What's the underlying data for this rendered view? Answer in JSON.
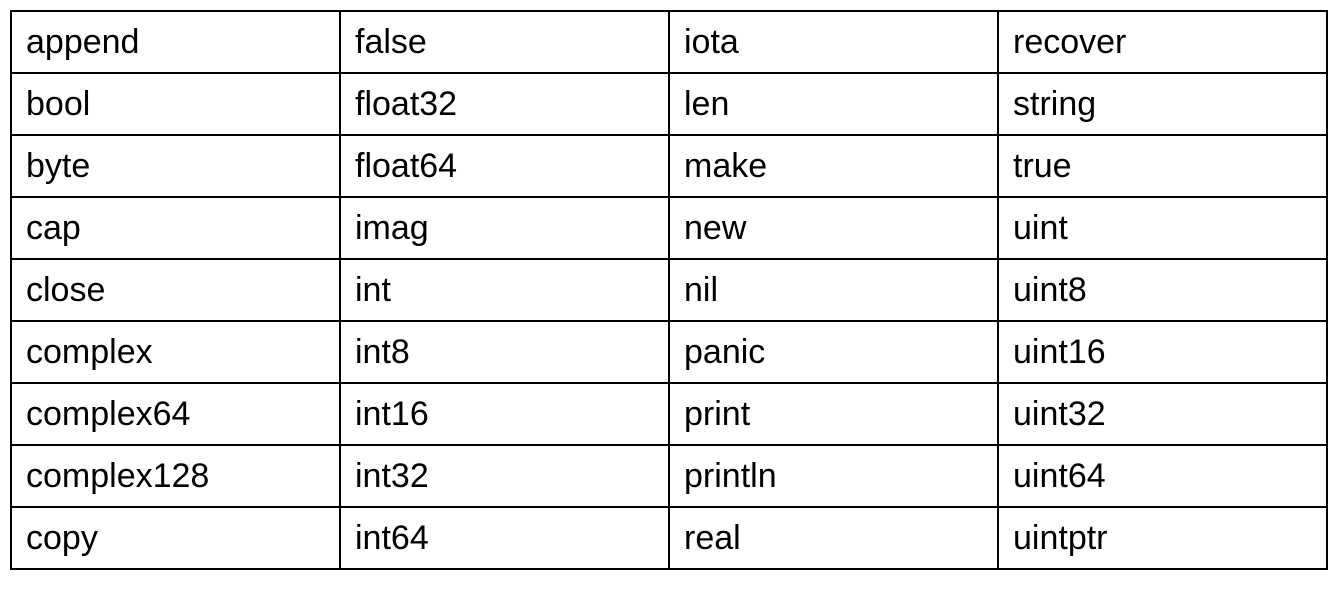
{
  "table": {
    "rows": [
      [
        "append",
        "false",
        "iota",
        "recover"
      ],
      [
        "bool",
        "float32",
        "len",
        "string"
      ],
      [
        "byte",
        "float64",
        "make",
        "true"
      ],
      [
        "cap",
        "imag",
        "new",
        "uint"
      ],
      [
        "close",
        "int",
        "nil",
        "uint8"
      ],
      [
        "complex",
        "int8",
        "panic",
        "uint16"
      ],
      [
        "complex64",
        "int16",
        "print",
        "uint32"
      ],
      [
        "complex128",
        "int32",
        "println",
        "uint64"
      ],
      [
        "copy",
        "int64",
        "real",
        "uintptr"
      ]
    ]
  }
}
